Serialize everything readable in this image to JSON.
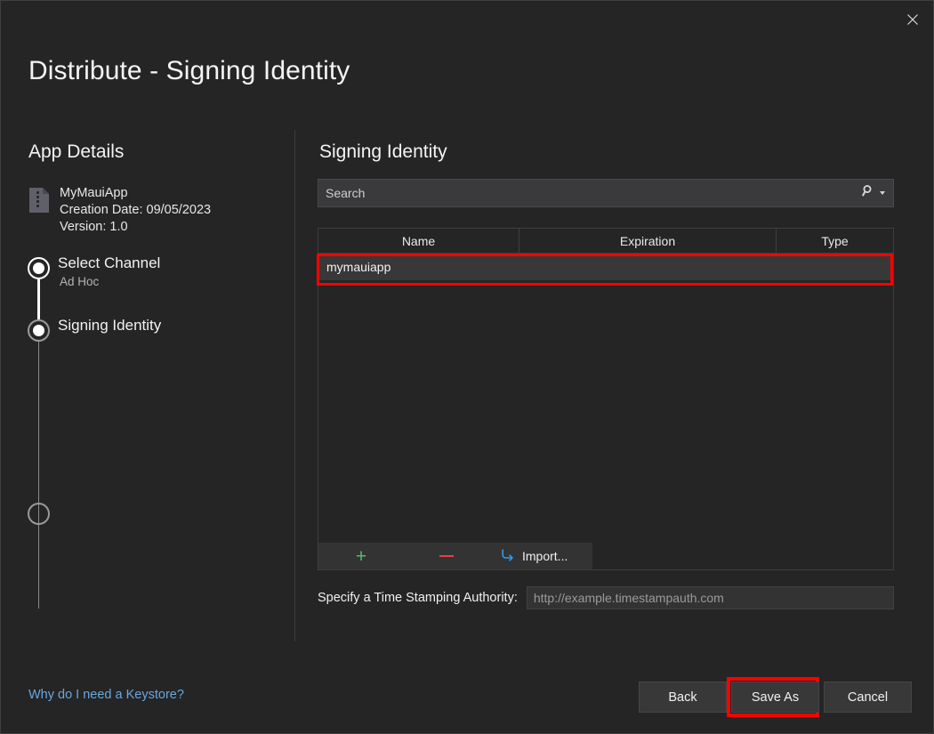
{
  "window": {
    "title": "Distribute - Signing Identity",
    "close_icon": "close-icon"
  },
  "sidebar": {
    "title": "App Details",
    "app": {
      "icon": "archive-file-icon",
      "name": "MyMauiApp",
      "creation_date": "Creation Date: 09/05/2023",
      "version": "Version: 1.0"
    },
    "steps": [
      {
        "label": "Select Channel",
        "sublabel": "Ad Hoc",
        "state": "completed"
      },
      {
        "label": "Signing Identity",
        "sublabel": "",
        "state": "current"
      },
      {
        "label": "",
        "sublabel": "",
        "state": "pending"
      }
    ]
  },
  "main": {
    "title": "Signing Identity",
    "search": {
      "placeholder": "Search",
      "value": "",
      "icon": "search-icon",
      "dropdown_icon": "chevron-down-icon"
    },
    "table": {
      "columns": [
        "Name",
        "Expiration",
        "Type"
      ],
      "rows": [
        {
          "name": "mymauiapp",
          "expiration": "",
          "type": "",
          "selected": true
        }
      ]
    },
    "table_toolbar": {
      "add_label": "+",
      "remove_label": "−",
      "import_label": "Import...",
      "add_icon": "plus-icon",
      "remove_icon": "minus-icon",
      "import_icon": "import-arrow-icon"
    },
    "timestamp": {
      "label": "Specify a Time Stamping Authority:",
      "placeholder": "http://example.timestampauth.com",
      "value": ""
    }
  },
  "footer": {
    "help_link": "Why do I need a Keystore?",
    "buttons": [
      {
        "label": "Back",
        "highlighted": false
      },
      {
        "label": "Save As",
        "highlighted": true
      },
      {
        "label": "Cancel",
        "highlighted": false
      }
    ]
  },
  "annotations": {
    "color": "#fe0000",
    "targets": [
      "selected-certificate-row",
      "save-as-button"
    ]
  }
}
